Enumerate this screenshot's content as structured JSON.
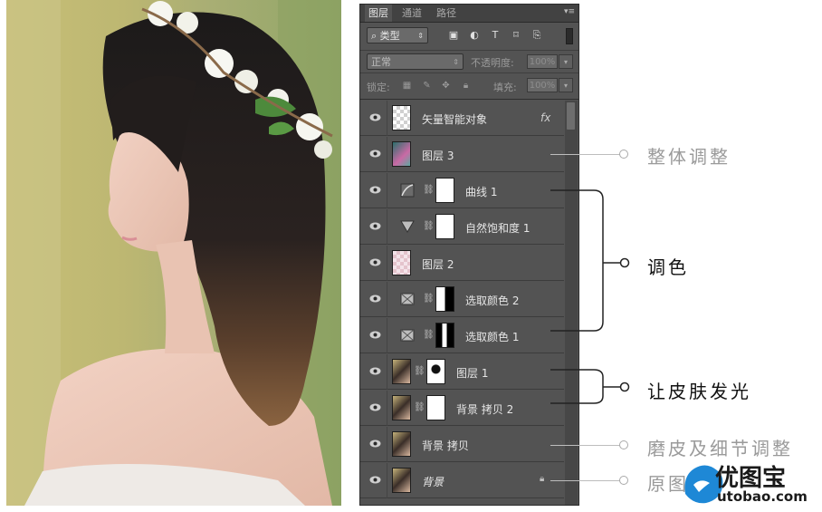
{
  "tabs": [
    "图层",
    "通道",
    "路径"
  ],
  "filter": {
    "kind_label": "类型"
  },
  "blend": {
    "mode": "正常",
    "opacity_label": "不透明度:",
    "opacity_value": "100%"
  },
  "lock": {
    "label": "锁定:",
    "fill_label": "填充:",
    "fill_value": "100%"
  },
  "layers": [
    {
      "name": "矢量智能对象",
      "badge": "fx"
    },
    {
      "name": "图层 3"
    },
    {
      "name": "曲线 1"
    },
    {
      "name": "自然饱和度 1"
    },
    {
      "name": "图层 2"
    },
    {
      "name": "选取颜色 2"
    },
    {
      "name": "选取颜色 1"
    },
    {
      "name": "图层 1"
    },
    {
      "name": "背景 拷贝 2"
    },
    {
      "name": "背景 拷贝"
    },
    {
      "name": "背景"
    }
  ],
  "annotations": {
    "overall": "整体调整",
    "color": "调色",
    "glow": "让皮肤发光",
    "smoothing": "磨皮及细节调整",
    "original": "原图"
  },
  "watermark": {
    "brand": "优图宝",
    "url": "utobao.com"
  },
  "colors": {
    "panel_bg": "#535353",
    "tab_bg": "#424242",
    "annotation_gray": "#9a9a9a",
    "watermark_blue": "#1e88d6"
  }
}
